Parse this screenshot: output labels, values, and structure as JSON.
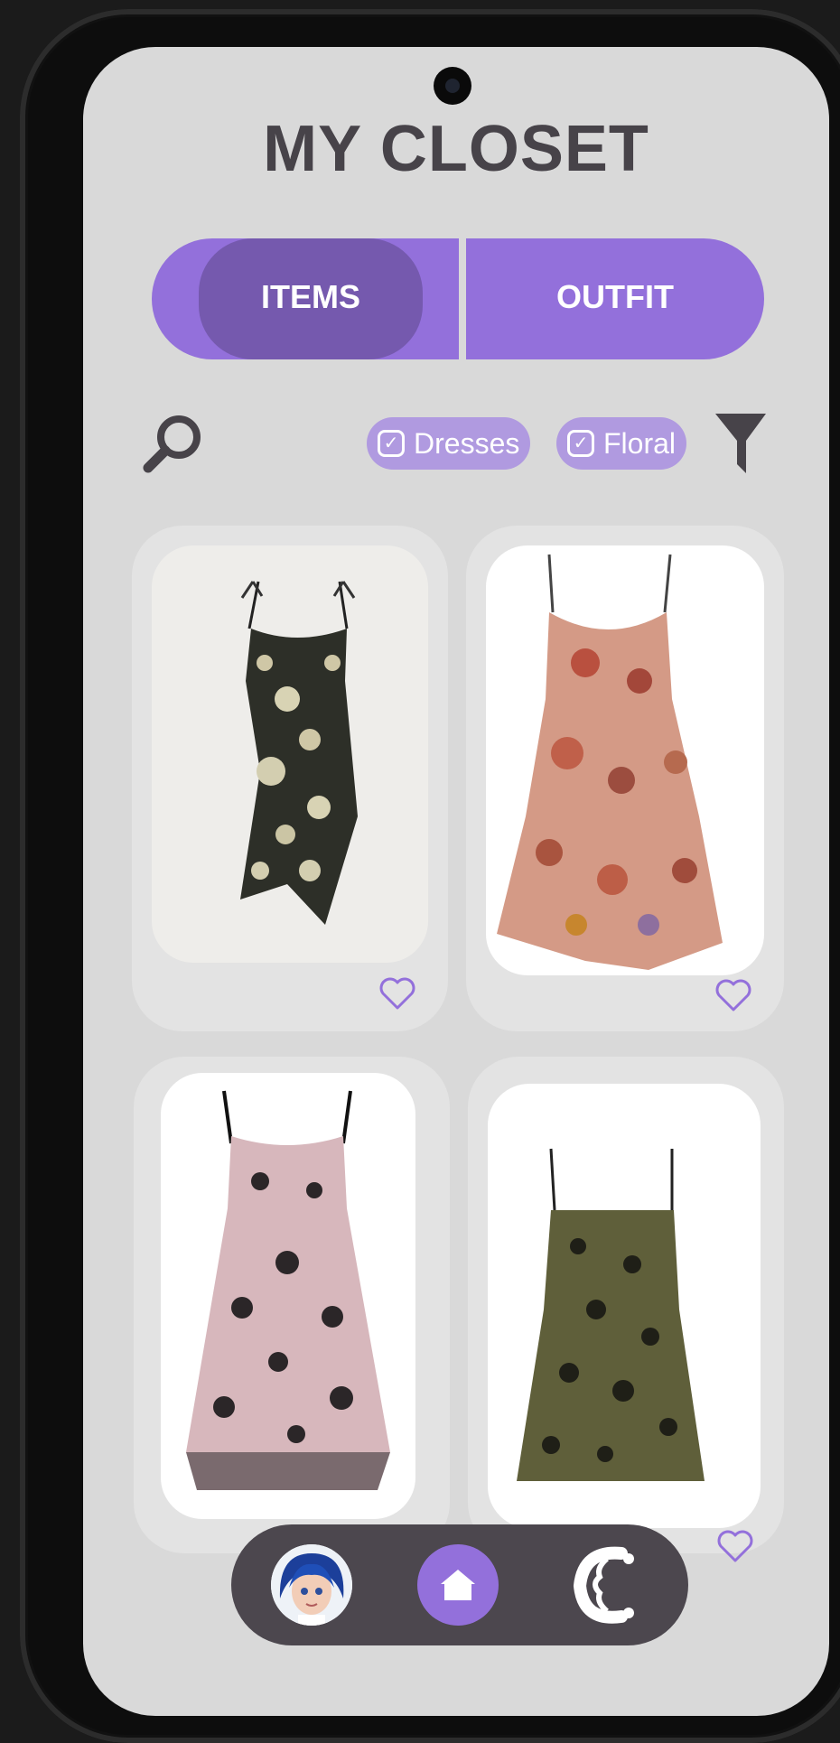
{
  "app": {
    "title": "MY CLOSET"
  },
  "tabs": [
    {
      "label": "ITEMS",
      "active": true
    },
    {
      "label": "OUTFIT",
      "active": false
    }
  ],
  "filters": [
    {
      "label": "Dresses",
      "checked": true
    },
    {
      "label": "Floral",
      "checked": true
    }
  ],
  "icons": {
    "search": "search-icon",
    "filter": "filter-icon",
    "heart": "heart-outline-icon",
    "home": "home-icon",
    "logo": "brand-logo-icon"
  },
  "items": [
    {
      "name": "black floral midi dress",
      "favorite": false
    },
    {
      "name": "pink ruffled floral dress",
      "favorite": false
    },
    {
      "name": "pink mesh floral dress",
      "favorite": false
    },
    {
      "name": "olive floral mini dress",
      "favorite": false
    }
  ],
  "colors": {
    "accent": "#9370db",
    "accent_dark": "#7559ae",
    "chip": "#b09ae0",
    "title": "#474349",
    "nav_bg": "#4c474e",
    "screen_bg": "#d9d9d9"
  }
}
